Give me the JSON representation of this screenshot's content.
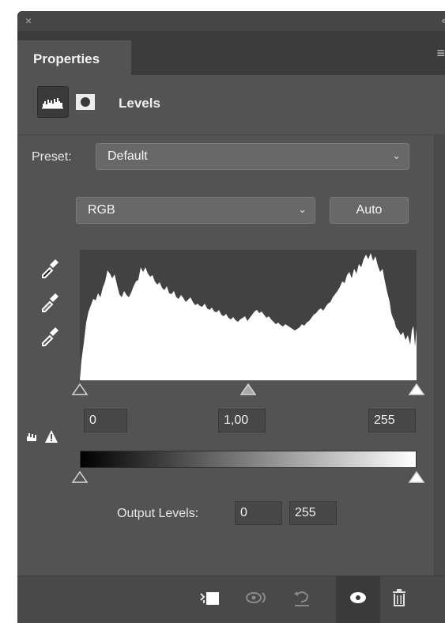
{
  "window": {
    "close_glyph": "×",
    "collapse_glyph": "‹‹",
    "menu_glyph": "≡"
  },
  "tabs": [
    {
      "label": "Properties"
    }
  ],
  "header": {
    "title": "Levels",
    "icons": [
      "levels-adjustment-icon",
      "mask-icon"
    ]
  },
  "preset": {
    "label": "Preset:",
    "value": "Default"
  },
  "channel": {
    "value": "RGB",
    "auto_label": "Auto"
  },
  "eyedroppers": [
    "black-point-eyedropper-icon",
    "gray-point-eyedropper-icon",
    "white-point-eyedropper-icon"
  ],
  "input_levels": {
    "black": "0",
    "gamma": "1,00",
    "white": "255"
  },
  "output_levels": {
    "label": "Output Levels:",
    "black": "0",
    "white": "255"
  },
  "bottom_icons": [
    "clip-to-layer-icon",
    "view-previous-state-icon",
    "reset-icon",
    "visibility-eye-icon",
    "delete-icon"
  ],
  "colors": {
    "panel": "#535353",
    "field": "#474747",
    "dropdown": "#686868",
    "histogram_bg": "#424242",
    "histogram_fill": "#ffffff"
  }
}
